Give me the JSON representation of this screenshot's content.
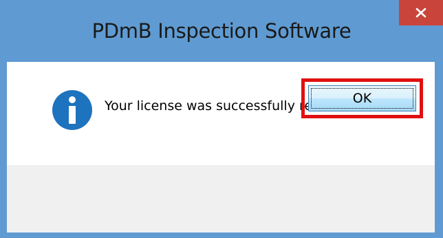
{
  "window": {
    "title": "PDmB Inspection Software",
    "close_label": "×"
  },
  "message": {
    "icon": "info-icon",
    "text": "Your license was successfully retrieved."
  },
  "buttons": {
    "ok_label": "OK"
  },
  "colors": {
    "titlebar": "#5f9bd2",
    "close_button": "#c9453b",
    "info_icon": "#1e73be",
    "highlight": "#e01010",
    "button_area": "#f0f0f0"
  }
}
